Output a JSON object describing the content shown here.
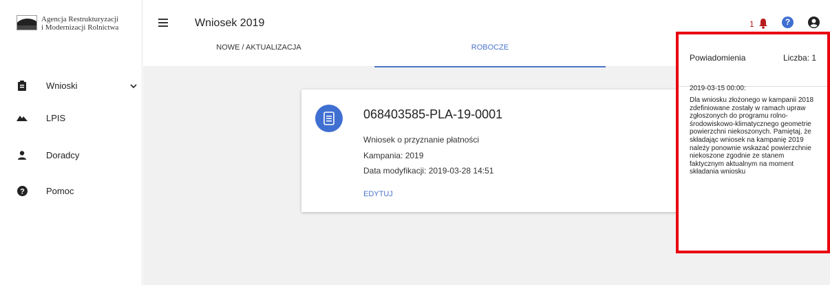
{
  "sidebar": {
    "logo_line1": "Agencja Restrukturyzacji",
    "logo_line2": "i Modernizacji Rolnictwa",
    "items": [
      {
        "label": "Wnioski",
        "icon": "clipboard-icon"
      },
      {
        "label": "LPIS",
        "icon": "mountains-icon"
      },
      {
        "label": "Doradcy",
        "icon": "person-icon"
      },
      {
        "label": "Pomoc",
        "icon": "help-circle-icon"
      }
    ]
  },
  "header": {
    "title": "Wniosek 2019",
    "notification_count": "1",
    "help_glyph": "?"
  },
  "tabs": [
    {
      "label": "NOWE / AKTUALIZACJA",
      "active": false
    },
    {
      "label": "ROBOCZE",
      "active": true
    }
  ],
  "card": {
    "id": "068403585-PLA-19-0001",
    "description": "Wniosek o przyznanie płatności",
    "campaign": "Kampania: 2019",
    "modified": "Data modyfikacji: 2019-03-28 14:51",
    "edit_label": "EDYTUJ"
  },
  "notifications": {
    "title": "Powiadomienia",
    "count_label": "Liczba: 1",
    "items": [
      {
        "date": "2019-03-15 00:00:",
        "message": "Dla wniosku złożonego w kampanii 2018 zdefiniowane zostały w ramach upraw zgłoszonych do programu rolno-środowiskowo-klimatycznego geometrie powierzchni niekoszonych. Pamiętaj, że składając wniosek na kampanię 2019 należy ponownie wskazać powierzchnie niekoszone zgodnie ze stanem faktycznym aktualnym na moment składania wniosku"
      }
    ]
  },
  "colors": {
    "accent": "#3f6fd1",
    "tab_active": "#4a74c8",
    "highlight_border": "#e8000f",
    "bell": "#b71c1c"
  }
}
